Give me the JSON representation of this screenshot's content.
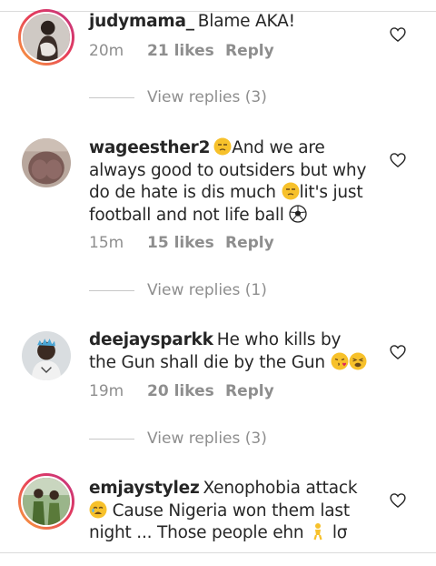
{
  "comments": [
    {
      "username": "judymama_",
      "text": "Blame AKA!",
      "time": "20m",
      "likes": "21 likes",
      "reply": "Reply",
      "view_replies": "View replies (3)",
      "avatar_icon": "profile-photo-icon",
      "story_ring": true
    },
    {
      "username": "wageesther2",
      "text_parts": [
        "And we are always good to outsiders but why do de hate is dis much ",
        "lit's just football and not life ball "
      ],
      "time": "15m",
      "likes": "15 likes",
      "reply": "Reply",
      "view_replies": "View replies (1)",
      "avatar_icon": "profile-photo-icon",
      "story_ring": false
    },
    {
      "username": "deejaysparkk",
      "text": "He who kills by the Gun shall die by the Gun ",
      "time": "19m",
      "likes": "20 likes",
      "reply": "Reply",
      "view_replies": "View replies (3)",
      "avatar_icon": "profile-photo-icon",
      "story_ring": false
    },
    {
      "username": "emjaystylez",
      "text_parts": [
        "Xenophobia attack ",
        " Cause Nigeria won them last night ... Those people ehn ",
        " lσ"
      ],
      "avatar_icon": "profile-photo-icon",
      "story_ring": true
    }
  ],
  "icons": {
    "like": "heart-outline-icon",
    "emoji_unamused": "unamused-face-icon",
    "emoji_soccer": "soccer-ball-icon",
    "emoji_kiss": "face-blowing-kiss-icon",
    "emoji_tired": "tired-face-icon",
    "emoji_weary": "weary-face-icon",
    "emoji_person": "person-standing-icon"
  },
  "colors": {
    "text": "#262626",
    "secondary": "#8e8e8e",
    "ring_start": "#f9a43c",
    "ring_end": "#c13584",
    "emoji_yellow": "#f7c12b"
  }
}
